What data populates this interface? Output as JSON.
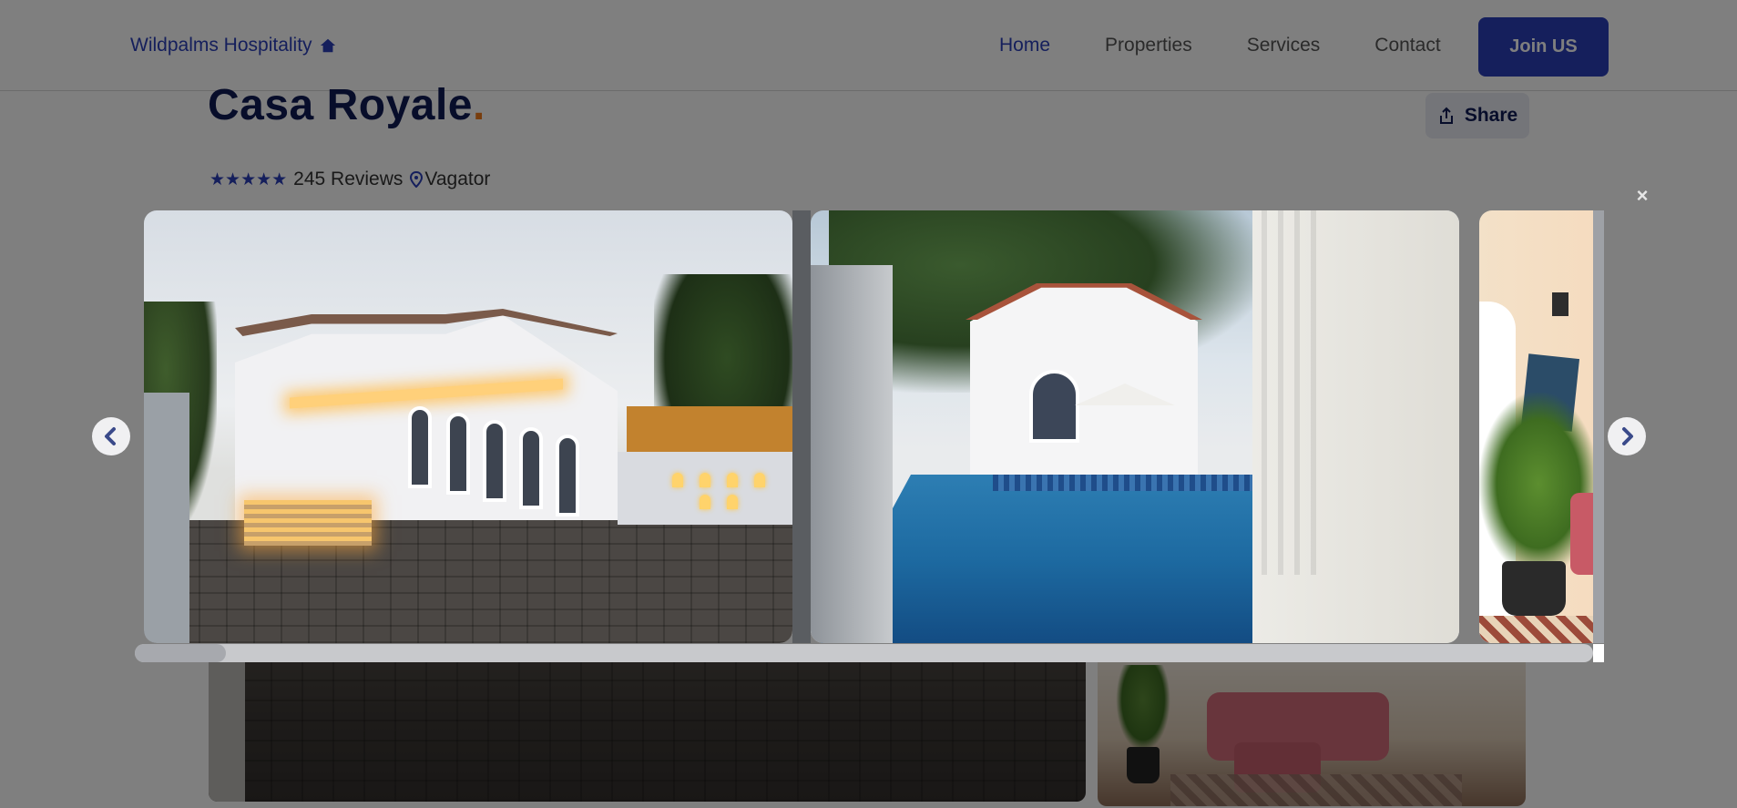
{
  "navbar": {
    "brand": "Wildpalms Hospitality",
    "links": [
      {
        "label": "Home",
        "active": true
      },
      {
        "label": "Properties",
        "active": false
      },
      {
        "label": "Services",
        "active": false
      },
      {
        "label": "Contact",
        "active": false
      }
    ],
    "cta_label": "Join US",
    "colors": {
      "brand": "#2b3fb8",
      "accent_dot": "#f07a1a"
    }
  },
  "property": {
    "title": "Casa Royale",
    "title_dot": ".",
    "share_label": "Share",
    "stars": "★★★★★",
    "reviews": "245 Reviews",
    "location": "Vagator"
  },
  "lightbox": {
    "close_symbol": "×",
    "prev_icon": "chevron-left-icon",
    "next_icon": "chevron-right-icon",
    "slides": [
      {
        "name": "villa-exterior"
      },
      {
        "name": "pool-area"
      },
      {
        "name": "living-room"
      }
    ]
  }
}
